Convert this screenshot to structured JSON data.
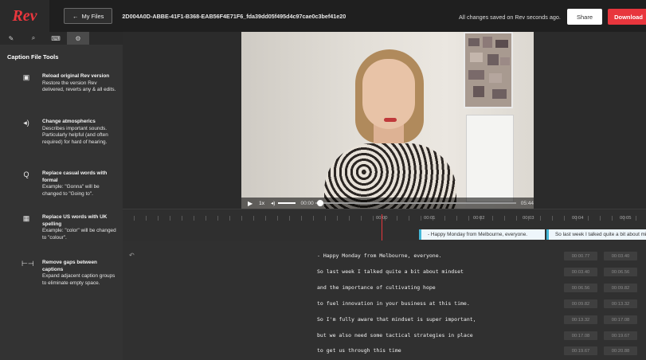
{
  "header": {
    "logo": "Rev",
    "my_files_label": "My Files",
    "my_files_arrow": "←",
    "file_id": "2D004A0D-ABBE-41F1-B368-EAB56F4E71F6_fda39dd05f495d4c97cae0c3bef41e20",
    "save_status": "All changes saved on Rev seconds ago.",
    "share_label": "Share",
    "download_label": "Download"
  },
  "sidebar": {
    "tabs": [
      {
        "icon": "pen-icon",
        "glyph": "✎"
      },
      {
        "icon": "search-icon",
        "glyph": "⌕"
      },
      {
        "icon": "keyboard-icon",
        "glyph": "⌨"
      },
      {
        "icon": "gear-icon",
        "glyph": "⚙"
      }
    ],
    "title": "Caption File Tools",
    "tools": [
      {
        "icon": "reload-file-icon",
        "glyph": "▣",
        "title": "Reload original Rev version",
        "desc": "Restore the version Rev delivered, reverts any & all edits."
      },
      {
        "icon": "speaker-icon",
        "glyph": "◂)",
        "title": "Change atmospherics",
        "desc": "Describes important sounds. Particularly helpful (and often required) for hard of hearing."
      },
      {
        "icon": "replace-words-icon",
        "glyph": "Q",
        "title": "Replace casual words with formal",
        "desc": "Example: \"Gonna\" will be changed to \"Going to\"."
      },
      {
        "icon": "uk-flag-icon",
        "glyph": "▦",
        "title": "Replace US words with UK spelling",
        "desc": "Example: \"color\" will be changed to \"colour\"."
      },
      {
        "icon": "remove-gaps-icon",
        "glyph": "⊢⊣",
        "title": "Remove gaps between captions",
        "desc": "Expand adjacent caption groups to eliminate empty space."
      }
    ]
  },
  "player": {
    "play_glyph": "▶",
    "speed": "1x",
    "volume_glyph": "◂)",
    "current_time": "00:00",
    "duration": "05:44",
    "progress": 0.0
  },
  "timeline": {
    "ticks": [
      "00:00",
      "00:01",
      "00:02",
      "00:03",
      "00:04",
      "00:05"
    ],
    "captions": [
      "- Happy Monday from Melbourne, everyone.",
      "So last week I talked quite a bit about mindset"
    ]
  },
  "transcript": {
    "undo_glyph": "↶",
    "lines": [
      {
        "text": "- Happy Monday from Melbourne, everyone.",
        "start": "00:00.77",
        "end": "00:03.40"
      },
      {
        "text": "So last week I talked quite a bit about mindset",
        "start": "00:03.40",
        "end": "00:06.56"
      },
      {
        "text": "and the importance of cultivating hope",
        "start": "00:06.56",
        "end": "00:09.82"
      },
      {
        "text": "to fuel innovation in your business at this time.",
        "start": "00:09.82",
        "end": "00:13.32"
      },
      {
        "text": "So I'm fully aware that mindset is super important,",
        "start": "00:13.32",
        "end": "00:17.08"
      },
      {
        "text": "but we also need some tactical strategies in place",
        "start": "00:17.08",
        "end": "00:19.67"
      },
      {
        "text": "to get us through this time",
        "start": "00:19.67",
        "end": "00:20.88"
      }
    ]
  }
}
